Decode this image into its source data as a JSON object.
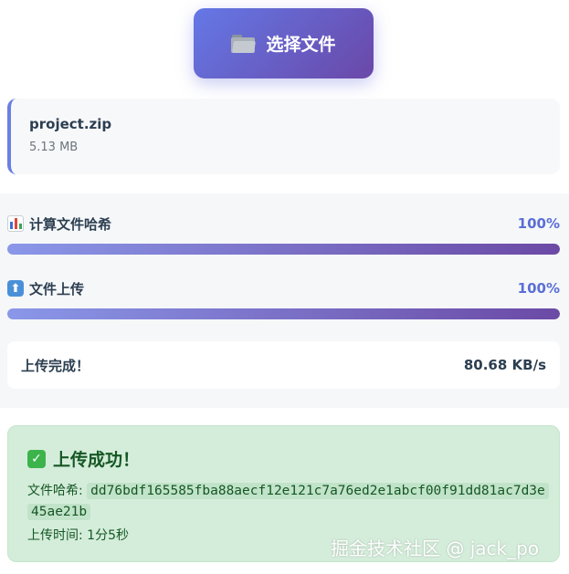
{
  "select_button": {
    "icon": "folder-icon",
    "label": "选择文件"
  },
  "file": {
    "name": "project.zip",
    "size": "5.13 MB"
  },
  "progress": [
    {
      "icon": "bar-chart-icon",
      "label": "计算文件哈希",
      "percent_text": "100%",
      "percent": 100
    },
    {
      "icon": "up-arrow-icon",
      "label": "文件上传",
      "percent_text": "100%",
      "percent": 100
    }
  ],
  "status": {
    "message": "上传完成！",
    "speed": "80.68 KB/s"
  },
  "result": {
    "icon": "check-icon",
    "title": "上传成功！",
    "hash_label": "文件哈希:",
    "hash_value": "dd76bdf165585fba88aecf12e121c7a76ed2e1abcf00f91dd81ac7d3e45ae21b",
    "time_label": "上传时间:",
    "time_value": "1分5秒"
  },
  "watermark": "掘金技术社区 @ jack_po",
  "colors": {
    "accent": "#6478e6",
    "accent_dark": "#6a48a8",
    "success_bg": "#d4edda",
    "success_text": "#155724"
  }
}
